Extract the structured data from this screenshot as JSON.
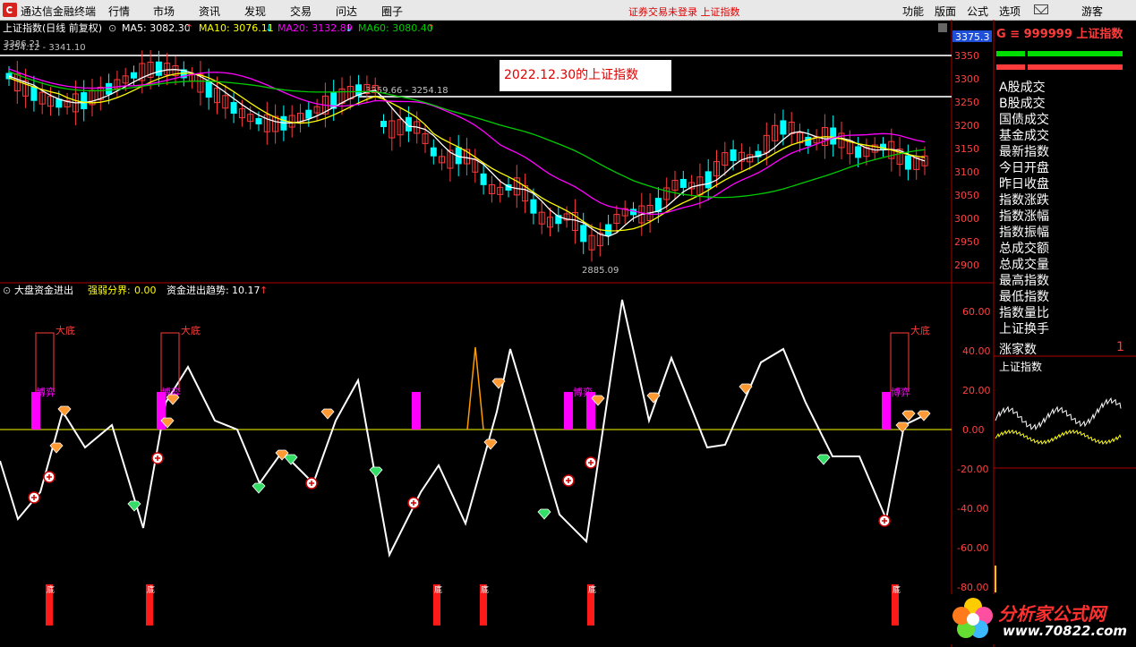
{
  "menubar": {
    "app_name": "通达信金融终端",
    "menus": [
      "行情",
      "市场",
      "资讯",
      "发现",
      "交易",
      "问达",
      "圈子"
    ],
    "notice": "证券交易未登录  上证指数",
    "right_menus": [
      "功能",
      "版面",
      "公式",
      "选项"
    ],
    "mail_icon": "mail-icon",
    "guest": "游客"
  },
  "watermark": "www.70822.com 分析家公式网",
  "main_chart": {
    "title": "上证指数(日线 前复权)",
    "ma5": "MA5: 3082.30",
    "ma10": "MA10: 3076.11",
    "ma20": "MA20: 3132.89",
    "ma60": "MA60: 3080.40",
    "price_tag": "3375.3",
    "high_label": "3386.21",
    "top_left_label": "3354.12 - 3341.10",
    "mid_label": "3259.66 - 3254.18",
    "low_label": "2885.09",
    "annotation": "2022.12.30的上证指数",
    "y_ticks": [
      "3350",
      "3300",
      "3250",
      "3200",
      "3150",
      "3100",
      "3050",
      "3000",
      "2950",
      "2900"
    ]
  },
  "indicator": {
    "title": "大盘资金进出",
    "strength_label": "强弱分界:",
    "strength_value": "0.00",
    "trend_label": "资金进出趋势:",
    "trend_value": "10.17",
    "bottom_label": "大底",
    "fight_label": "博弈",
    "bottom_bar_label": "底",
    "y_ticks": [
      "60.00",
      "40.00",
      "20.00",
      "0.00",
      "-20.00",
      "-40.00",
      "-60.00",
      "-80.00"
    ]
  },
  "right_panel": {
    "quote": "G ≡ 999999 上证指数",
    "items": [
      "A股成交",
      "B股成交",
      "国债成交",
      "基金成交",
      "最新指数",
      "今日开盘",
      "昨日收盘",
      "指数涨跌",
      "指数涨幅",
      "指数振幅",
      "总成交额",
      "总成交量",
      "最高指数",
      "最低指数",
      "指数量比",
      "上证换手"
    ],
    "up_count_label": "涨家数",
    "up_count_value": "1",
    "mini_title": "上证指数"
  },
  "brand": {
    "name": "分析家公式网",
    "url": "www.70822.com"
  },
  "colors": {
    "up": "#ff3b3b",
    "down": "#00ffff",
    "ma5": "#ffffff",
    "ma10": "#ffff00",
    "ma20": "#ff00ff",
    "ma60": "#00cc00",
    "fund_line": "#ffffff",
    "zero_line": "#ffff00"
  }
}
